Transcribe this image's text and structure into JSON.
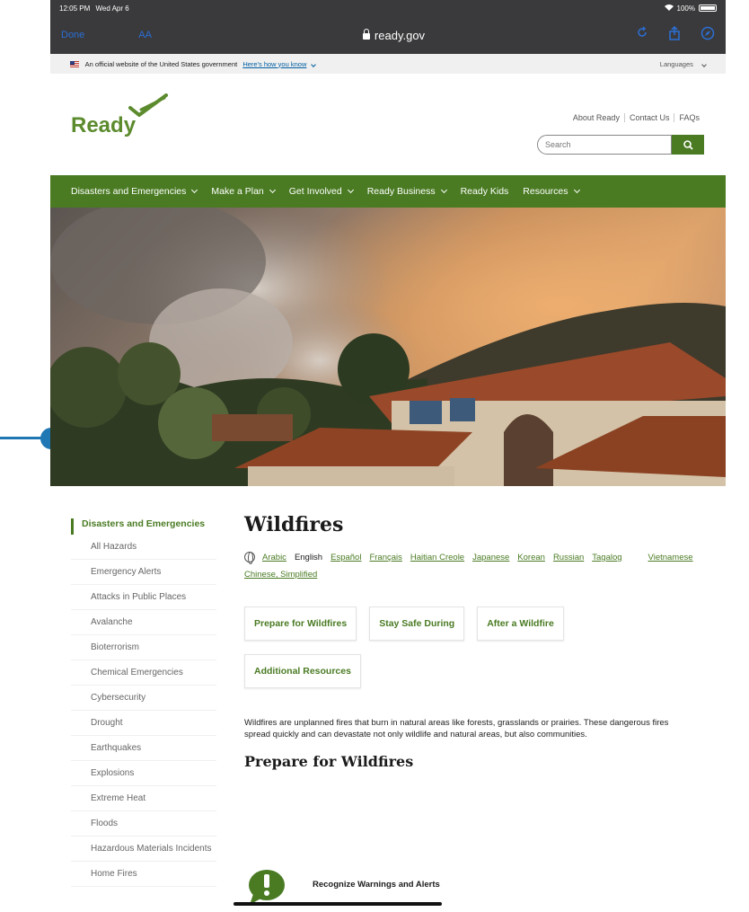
{
  "status": {
    "time": "12:05 PM",
    "date": "Wed Apr 6",
    "battery": "100%"
  },
  "browser": {
    "done_label": "Done",
    "text_size_label": "AA",
    "url": "ready.gov"
  },
  "gov_banner": {
    "text": "An official website of the United States government",
    "link": "Here's how you know",
    "languages": "Languages"
  },
  "header": {
    "logo_text": "Ready",
    "links": [
      "About Ready",
      "Contact Us",
      "FAQs"
    ],
    "search_placeholder": "Search"
  },
  "nav": [
    {
      "label": "Disasters and Emergencies",
      "has_menu": true
    },
    {
      "label": "Make a Plan",
      "has_menu": true
    },
    {
      "label": "Get Involved",
      "has_menu": true
    },
    {
      "label": "Ready Business",
      "has_menu": true
    },
    {
      "label": "Ready Kids",
      "has_menu": false
    },
    {
      "label": "Resources",
      "has_menu": true
    }
  ],
  "sidebar": {
    "title": "Disasters and Emergencies",
    "items": [
      "All Hazards",
      "Emergency Alerts",
      "Attacks in Public Places",
      "Avalanche",
      "Bioterrorism",
      "Chemical Emergencies",
      "Cybersecurity",
      "Drought",
      "Earthquakes",
      "Explosions",
      "Extreme Heat",
      "Floods",
      "Hazardous Materials Incidents",
      "Home Fires"
    ]
  },
  "main": {
    "title": "Wildfires",
    "languages": [
      "Arabic",
      "English",
      "Español",
      "Français",
      "Haitian Creole",
      "Japanese",
      "Korean",
      "Russian",
      "Tagalog",
      "Vietnamese",
      "Chinese, Simplified"
    ],
    "current_language": "English",
    "tabs": [
      "Prepare for Wildfires",
      "Stay Safe During",
      "After a Wildfire",
      "Additional Resources"
    ],
    "description": "Wildfires are unplanned fires that burn in natural areas like forests, grasslands or prairies. These dangerous fires spread quickly and can devastate not only wildlife and natural areas, but also communities.",
    "section_title": "Prepare for Wildfires",
    "alert_item": "Recognize Warnings and Alerts"
  },
  "colors": {
    "brand_green": "#4a7b23",
    "browser_chrome": "#3a3a3c",
    "marker_blue": "#1f77b4"
  }
}
